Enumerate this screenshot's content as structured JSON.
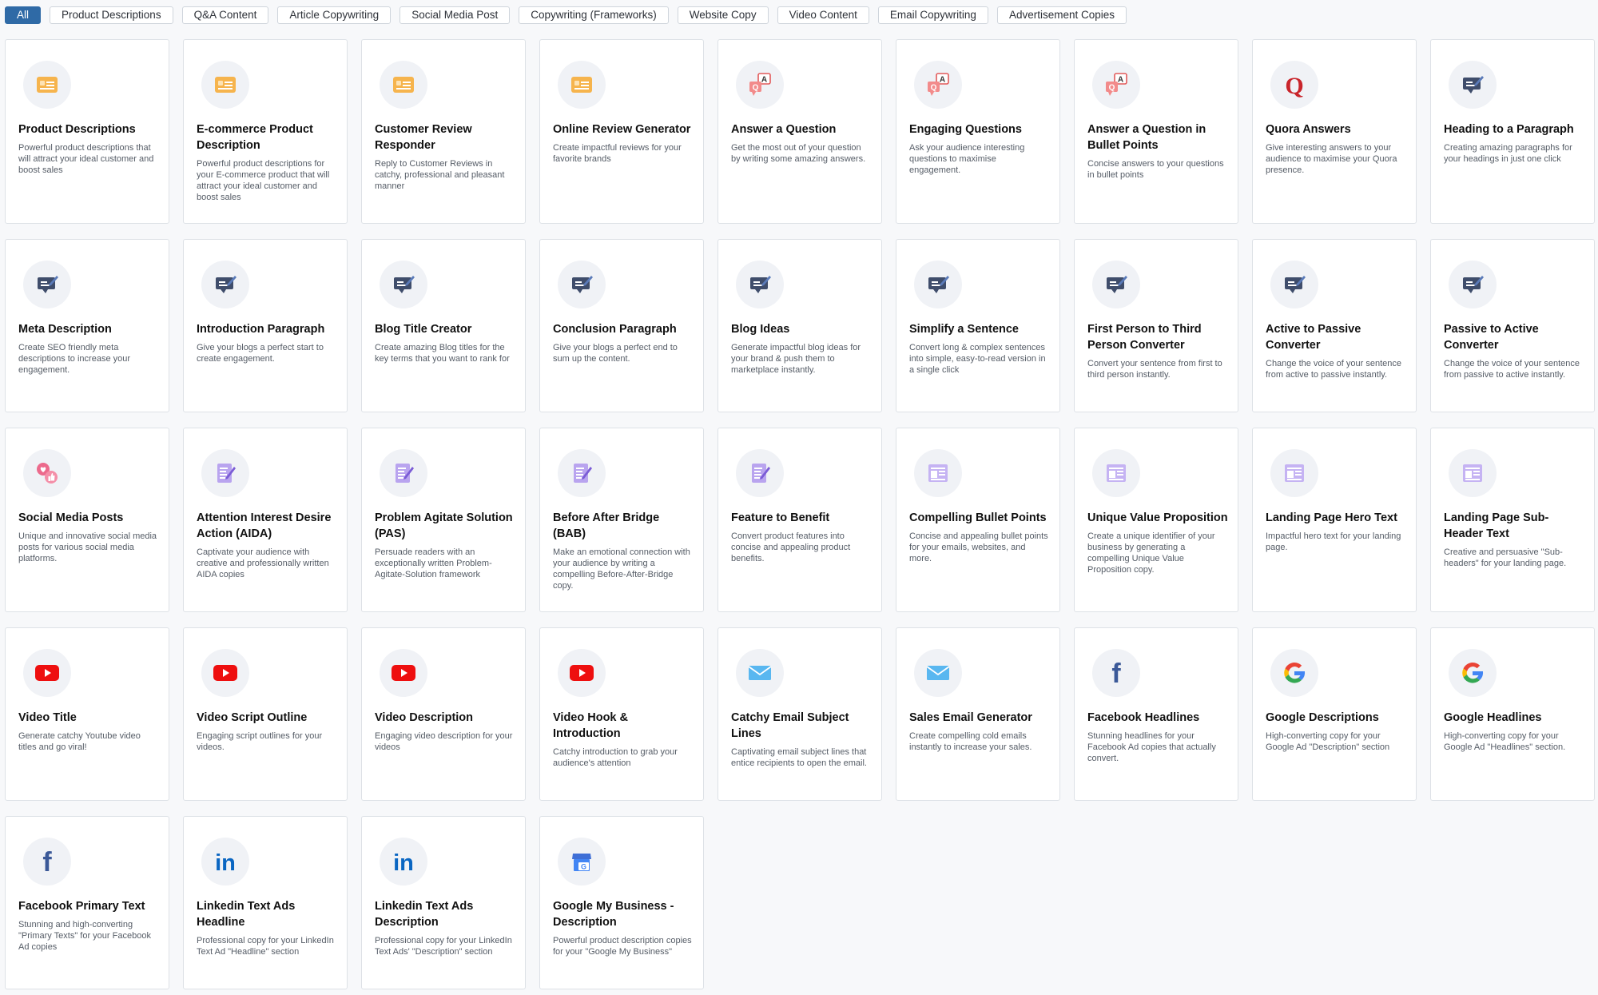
{
  "filters": [
    {
      "label": "All",
      "active": true
    },
    {
      "label": "Product Descriptions",
      "active": false
    },
    {
      "label": "Q&A Content",
      "active": false
    },
    {
      "label": "Article Copywriting",
      "active": false
    },
    {
      "label": "Social Media Post",
      "active": false
    },
    {
      "label": "Copywriting (Frameworks)",
      "active": false
    },
    {
      "label": "Website Copy",
      "active": false
    },
    {
      "label": "Video Content",
      "active": false
    },
    {
      "label": "Email Copywriting",
      "active": false
    },
    {
      "label": "Advertisement Copies",
      "active": false
    }
  ],
  "cards": [
    {
      "icon": "product-icon",
      "title": "Product Descriptions",
      "desc": "Powerful product descriptions that will attract your ideal customer and boost sales"
    },
    {
      "icon": "product-icon",
      "title": "E-commerce Product Description",
      "desc": "Powerful product descriptions for your E-commerce product that will attract your ideal customer and boost sales"
    },
    {
      "icon": "product-icon",
      "title": "Customer Review Responder",
      "desc": "Reply to Customer Reviews in catchy, professional and pleasant manner"
    },
    {
      "icon": "product-icon",
      "title": "Online Review Generator",
      "desc": "Create impactful reviews for your favorite brands"
    },
    {
      "icon": "qa-icon",
      "title": "Answer a Question",
      "desc": "Get the most out of your question by writing some amazing answers."
    },
    {
      "icon": "qa-icon",
      "title": "Engaging Questions",
      "desc": "Ask your audience interesting questions to maximise engagement."
    },
    {
      "icon": "qa-icon",
      "title": "Answer a Question in Bullet Points",
      "desc": "Concise answers to your questions in bullet points"
    },
    {
      "icon": "quora-icon",
      "title": "Quora Answers",
      "desc": "Give interesting answers to your audience to maximise your Quora presence."
    },
    {
      "icon": "article-icon",
      "title": "Heading to a Paragraph",
      "desc": "Creating amazing paragraphs for your headings in just one click"
    },
    {
      "icon": "article-icon",
      "title": "Meta Description",
      "desc": "Create SEO friendly meta descriptions to increase your engagement."
    },
    {
      "icon": "article-icon",
      "title": "Introduction Paragraph",
      "desc": "Give your blogs a perfect start to create engagement."
    },
    {
      "icon": "article-icon",
      "title": "Blog Title Creator",
      "desc": "Create amazing Blog titles for the key terms that you want to rank for"
    },
    {
      "icon": "article-icon",
      "title": "Conclusion Paragraph",
      "desc": "Give your blogs a perfect end to sum up the content."
    },
    {
      "icon": "article-icon",
      "title": "Blog Ideas",
      "desc": "Generate impactful blog ideas for your brand & push them to marketplace instantly."
    },
    {
      "icon": "article-icon",
      "title": "Simplify a Sentence",
      "desc": "Convert long & complex sentences into simple, easy-to-read version in a single click"
    },
    {
      "icon": "article-icon",
      "title": "First Person to Third Person Converter",
      "desc": "Convert your sentence from first to third person instantly."
    },
    {
      "icon": "article-icon",
      "title": "Active to Passive Converter",
      "desc": "Change the voice of your sentence from active to passive instantly."
    },
    {
      "icon": "article-icon",
      "title": "Passive to Active Converter",
      "desc": "Change the voice of your sentence from passive to active instantly."
    },
    {
      "icon": "social-icon",
      "title": "Social Media Posts",
      "desc": "Unique and innovative social media posts for various social media platforms."
    },
    {
      "icon": "framework-icon",
      "title": "Attention Interest Desire Action (AIDA)",
      "desc": "Captivate your audience with creative and professionally written AIDA copies"
    },
    {
      "icon": "framework-icon",
      "title": "Problem Agitate Solution (PAS)",
      "desc": "Persuade readers with an exceptionally written Problem-Agitate-Solution framework"
    },
    {
      "icon": "framework-icon",
      "title": "Before After Bridge (BAB)",
      "desc": "Make an emotional connection with your audience by writing a compelling Before-After-Bridge copy."
    },
    {
      "icon": "framework-icon",
      "title": "Feature to Benefit",
      "desc": "Convert product features into concise and appealing product benefits."
    },
    {
      "icon": "website-icon",
      "title": "Compelling Bullet Points",
      "desc": "Concise and appealing bullet points for your emails, websites, and more."
    },
    {
      "icon": "website-icon",
      "title": "Unique Value Proposition",
      "desc": "Create a unique identifier of your business by generating a compelling Unique Value Proposition copy."
    },
    {
      "icon": "website-icon",
      "title": "Landing Page Hero Text",
      "desc": "Impactful hero text for your landing page."
    },
    {
      "icon": "website-icon",
      "title": "Landing Page Sub-Header Text",
      "desc": "Creative and persuasive \"Sub-headers\" for your landing page."
    },
    {
      "icon": "youtube-icon",
      "title": "Video Title",
      "desc": "Generate catchy Youtube video titles and go viral!"
    },
    {
      "icon": "youtube-icon",
      "title": "Video Script Outline",
      "desc": "Engaging script outlines for your videos."
    },
    {
      "icon": "youtube-icon",
      "title": "Video Description",
      "desc": "Engaging video description for your videos"
    },
    {
      "icon": "youtube-icon",
      "title": "Video Hook & Introduction",
      "desc": "Catchy introduction to grab your audience's attention"
    },
    {
      "icon": "email-icon",
      "title": "Catchy Email Subject Lines",
      "desc": "Captivating email subject lines that entice recipients to open the email."
    },
    {
      "icon": "email-icon",
      "title": "Sales Email Generator",
      "desc": "Create compelling cold emails instantly to increase your sales."
    },
    {
      "icon": "facebook-icon",
      "title": "Facebook Headlines",
      "desc": "Stunning headlines for your Facebook Ad copies that actually convert."
    },
    {
      "icon": "google-icon",
      "title": "Google Descriptions",
      "desc": "High-converting copy for your Google Ad \"Description\" section"
    },
    {
      "icon": "google-icon",
      "title": "Google Headlines",
      "desc": "High-converting copy for your Google Ad \"Headlines\" section."
    },
    {
      "icon": "facebook-icon",
      "title": "Facebook Primary Text",
      "desc": "Stunning and high-converting \"Primary Texts\" for your Facebook Ad copies"
    },
    {
      "icon": "linkedin-icon",
      "title": "Linkedin Text Ads Headline",
      "desc": "Professional copy for your LinkedIn Text Ad \"Headline\" section"
    },
    {
      "icon": "linkedin-icon",
      "title": "Linkedin Text Ads Description",
      "desc": "Professional copy for your LinkedIn Text Ads' \"Description\" section"
    },
    {
      "icon": "gmb-icon",
      "title": "Google My Business - Description",
      "desc": "Powerful product description copies for your \"Google My Business\""
    }
  ]
}
